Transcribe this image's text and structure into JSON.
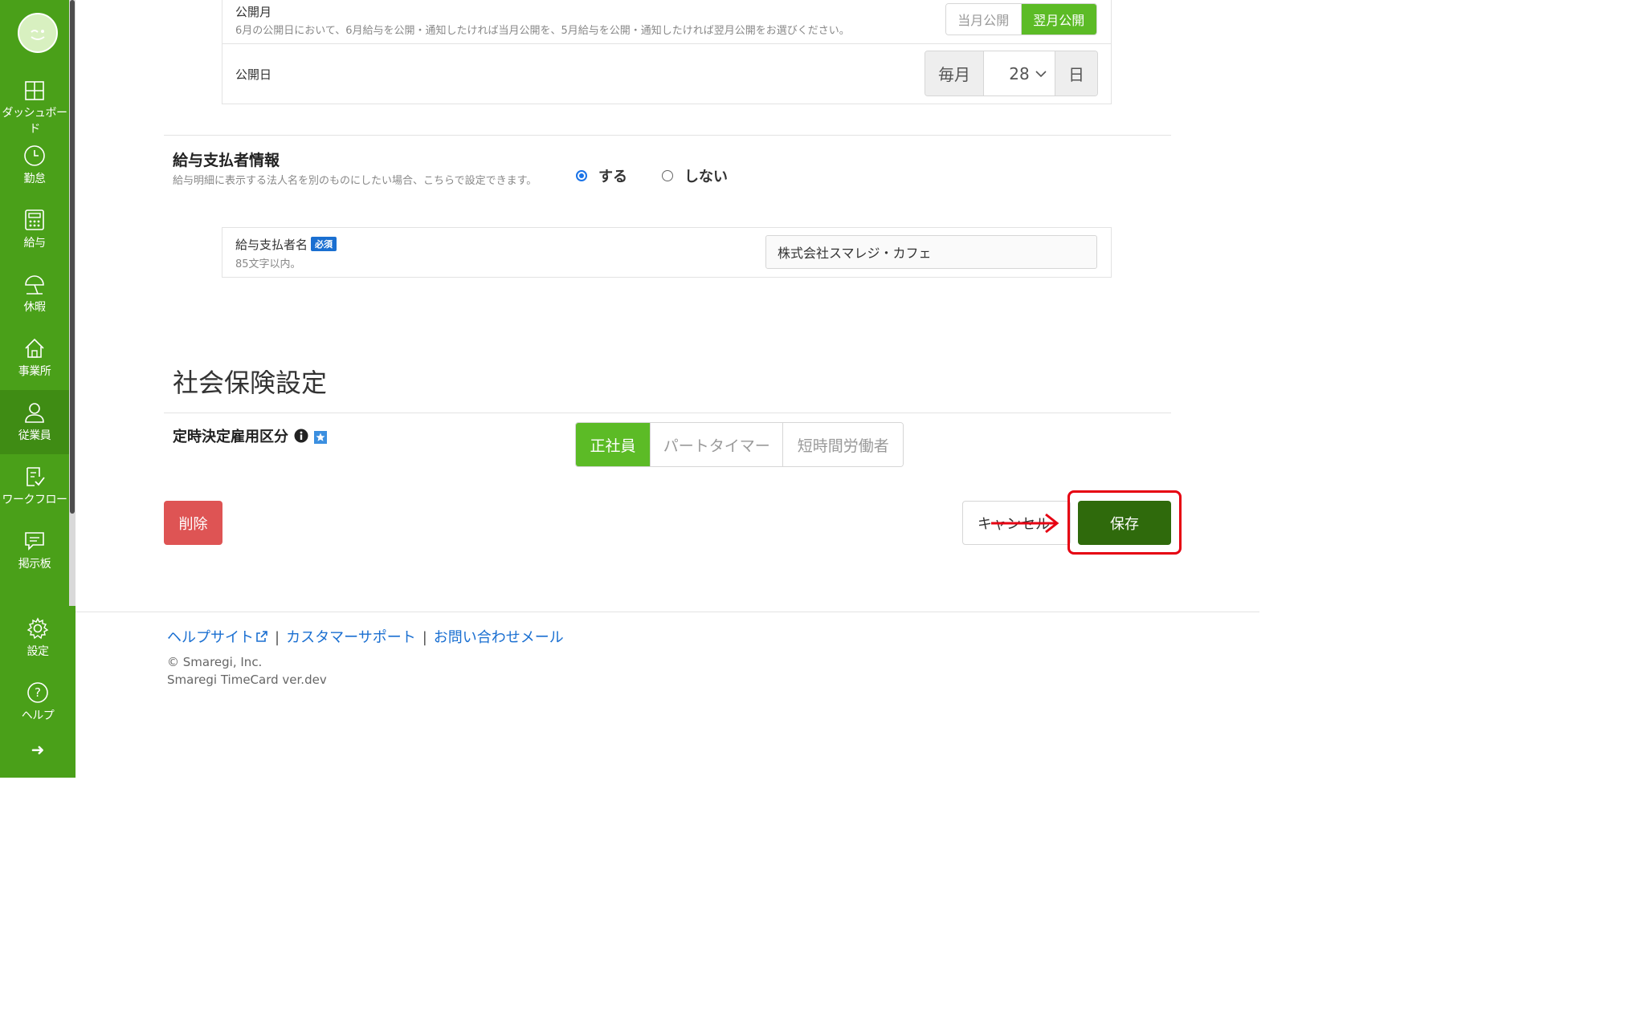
{
  "sidebar": {
    "items": [
      {
        "label": "ダッシュボード",
        "icon": "dashboard-icon"
      },
      {
        "label": "勤怠",
        "icon": "clock-icon"
      },
      {
        "label": "給与",
        "icon": "calculator-icon"
      },
      {
        "label": "休暇",
        "icon": "umbrella-icon"
      },
      {
        "label": "事業所",
        "icon": "home-icon"
      },
      {
        "label": "従業員",
        "icon": "user-icon",
        "active": true
      },
      {
        "label": "ワークフロー",
        "icon": "checklist-icon"
      },
      {
        "label": "掲示板",
        "icon": "chat-icon"
      }
    ],
    "bottom_items": [
      {
        "label": "設定",
        "icon": "gear-icon"
      },
      {
        "label": "ヘルプ",
        "icon": "question-icon"
      }
    ],
    "expand_glyph": "➜"
  },
  "publish": {
    "month_label": "公開月",
    "month_help": "6月の公開日において、6月給与を公開・通知したければ当月公開を、5月給与を公開・通知したければ翌月公開をお選びください。",
    "month_options": [
      "当月公開",
      "翌月公開"
    ],
    "month_selected": "翌月公開",
    "day_label": "公開日",
    "day_prefix": "毎月",
    "day_value": "28",
    "day_suffix": "日"
  },
  "payer": {
    "title": "給与支払者情報",
    "help": "給与明細に表示する法人名を別のものにしたい場合、こちらで設定できます。",
    "radio_yes": "する",
    "radio_no": "しない",
    "selected": "する",
    "name_label": "給与支払者名",
    "required_badge": "必須",
    "name_help": "85文字以内。",
    "name_value": "株式会社スマレジ・カフェ"
  },
  "social": {
    "section_title": "社会保険設定",
    "field_label": "定時決定雇用区分",
    "options": [
      "正社員",
      "パートタイマー",
      "短時間労働者"
    ],
    "selected": "正社員"
  },
  "actions": {
    "delete": "削除",
    "cancel": "キャンセル",
    "save": "保存"
  },
  "footer": {
    "help_site": "ヘルプサイト",
    "customer_support": "カスタマーサポート",
    "contact_mail": "お問い合わせメール",
    "copyright": "© Smaregi, Inc.",
    "version": "Smaregi TimeCard ver.dev"
  },
  "colors": {
    "sidebar_green": "#4aa019",
    "accent_green": "#5cbb26",
    "save_green": "#2f6a0c",
    "delete_red": "#de5454",
    "link_blue": "#1a6fd1",
    "highlight_red": "#e60012"
  }
}
